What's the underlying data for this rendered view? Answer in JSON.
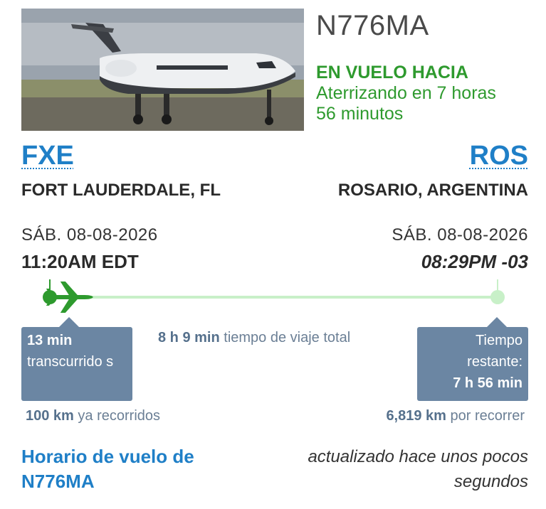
{
  "aircraft": {
    "tail_number": "N776MA",
    "status": "EN VUELO HACIA",
    "eta_text": "Aterrizando en 7 horas 56 minutos"
  },
  "origin": {
    "code": "FXE",
    "city": "FORT LAUDERDALE, FL",
    "date": "SÁB. 08-08-2026",
    "time": "11:20AM EDT"
  },
  "destination": {
    "code": "ROS",
    "city": "ROSARIO, ARGENTINA",
    "date": "SÁB. 08-08-2026",
    "time": "08:29PM -03"
  },
  "progress": {
    "fraction_complete": 0.014,
    "elapsed_value": "13 min",
    "elapsed_label": "transcurrido s",
    "total_value": "8 h 9 min",
    "total_label": "tiempo de viaje total",
    "remaining_label": "Tiempo restante:",
    "remaining_value": "7 h 56 min",
    "covered_value": "100 km",
    "covered_label": "ya recorridos",
    "left_value": "6,819 km",
    "left_label": "por recorrer"
  },
  "footer": {
    "schedule_link": "Horario de vuelo de N776MA",
    "updated_text": "actualizado hace unos pocos segundos"
  },
  "colors": {
    "accent_blue": "#1f7fc7",
    "status_green": "#2e9a2e",
    "track_green": "#c8f0c8",
    "info_box": "#6b86a3"
  },
  "icons": {
    "plane": "airplane-icon"
  }
}
